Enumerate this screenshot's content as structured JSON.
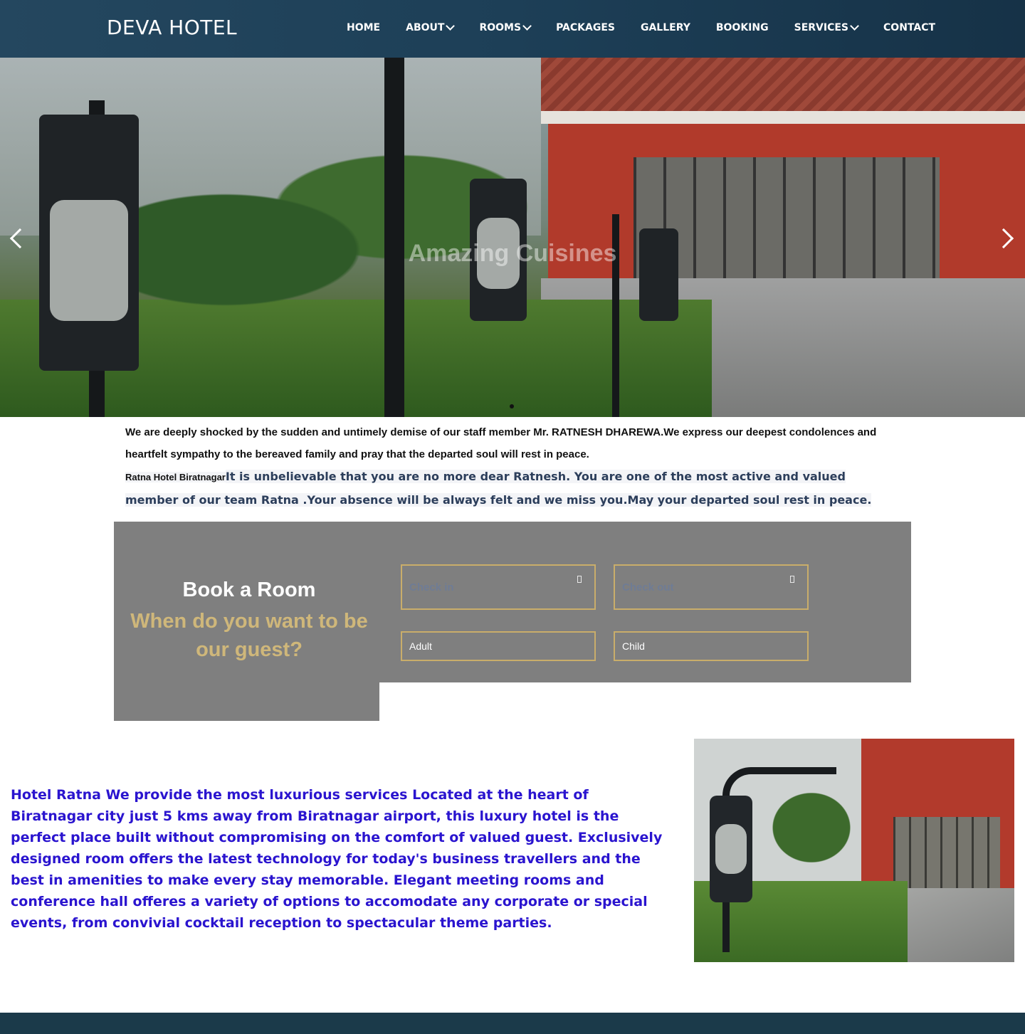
{
  "header": {
    "brand": "DEVA HOTEL",
    "nav": [
      {
        "label": "HOME",
        "dropdown": false
      },
      {
        "label": "ABOUT",
        "dropdown": true
      },
      {
        "label": "ROOMS",
        "dropdown": true
      },
      {
        "label": "PACKAGES",
        "dropdown": false
      },
      {
        "label": "GALLERY",
        "dropdown": false
      },
      {
        "label": "BOOKING",
        "dropdown": false
      },
      {
        "label": "SERVICES",
        "dropdown": true
      },
      {
        "label": "CONTACT",
        "dropdown": false
      }
    ]
  },
  "hero": {
    "caption": "Amazing Cuisines",
    "slide_indicator_icon": "dot-indicator",
    "prev_icon": "chevron-left-icon",
    "next_icon": "chevron-right-icon"
  },
  "notice": {
    "message": "We are deeply shocked by the sudden and untimely demise of our staff member Mr. RATNESH DHAREWA.We express our deepest condolences and heartfelt sympathy to the bereaved family and pray that the departed soul will rest in peace.",
    "source": "Ratna Hotel Biratnagar",
    "tribute": "It is unbelievable that you are no more dear Ratnesh. You are one of the most active and valued member of our team Ratna .Your absence will be always felt and we miss you.May your departed soul rest in peace."
  },
  "booking": {
    "title": "Book a Room",
    "subtitle": "When do you want to be our guest?",
    "check_in_placeholder": "Check in",
    "check_out_placeholder": "Check out",
    "adult_placeholder": "Adult",
    "child_placeholder": "Child",
    "calendar_icon": "calendar-icon"
  },
  "about": {
    "text": "Hotel Ratna We provide the most luxurious services Located at the heart of Biratnagar city just 5 kms away from Biratnagar airport, this luxury hotel is the perfect place built without compromising on the comfort of valued guest. Exclusively designed room offers the latest technology for today's business travellers and the best in amenities to make every stay memorable. Elegant meeting rooms and conference hall offeres a variety of options to accomodate any corporate or special events, from convivial cocktail reception to spectacular theme parties."
  },
  "colors": {
    "navbar": "#1f4258",
    "booking_panel": "#7f7f7f",
    "gold_accent": "#cfb77a",
    "about_text": "#2a14cf",
    "footer": "#1b3a4a"
  }
}
